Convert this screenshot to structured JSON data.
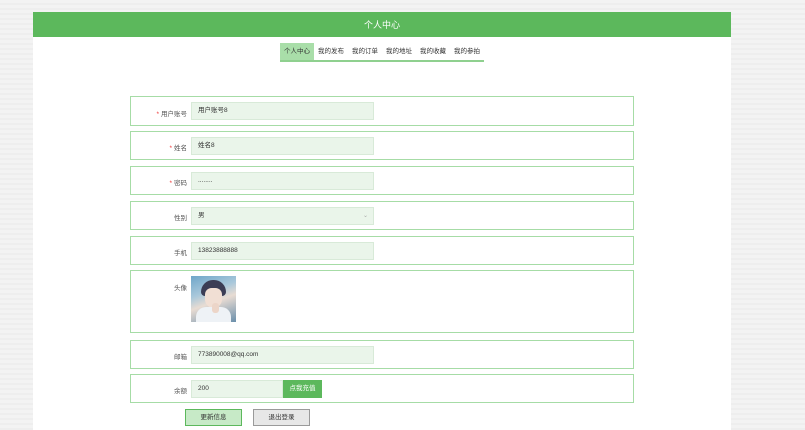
{
  "header": {
    "title": "个人中心"
  },
  "tabs": [
    {
      "label": "个人中心",
      "active": true
    },
    {
      "label": "我的发布",
      "active": false
    },
    {
      "label": "我的订单",
      "active": false
    },
    {
      "label": "我的地址",
      "active": false
    },
    {
      "label": "我的收藏",
      "active": false
    },
    {
      "label": "我的参拍",
      "active": false
    }
  ],
  "form": {
    "required_mark": "*",
    "account": {
      "label": "用户账号",
      "value": "用户账号8"
    },
    "name": {
      "label": "姓名",
      "value": "姓名8"
    },
    "password": {
      "label": "密码",
      "value": "........"
    },
    "gender": {
      "label": "性别",
      "value": "男",
      "arrow": "⌄"
    },
    "phone": {
      "label": "手机",
      "value": "13823888888"
    },
    "avatar": {
      "label": "头像"
    },
    "email": {
      "label": "邮箱",
      "value": "773890008@qq.com"
    },
    "balance": {
      "label": "余额",
      "value": "200",
      "recharge_label": "点我充值"
    }
  },
  "actions": {
    "update_label": "更新信息",
    "logout_label": "退出登录"
  },
  "colors": {
    "primary": "#5cb85c",
    "tab_active": "#a9dea9",
    "border": "#a6dca6",
    "field_bg": "#eaf5ea"
  }
}
